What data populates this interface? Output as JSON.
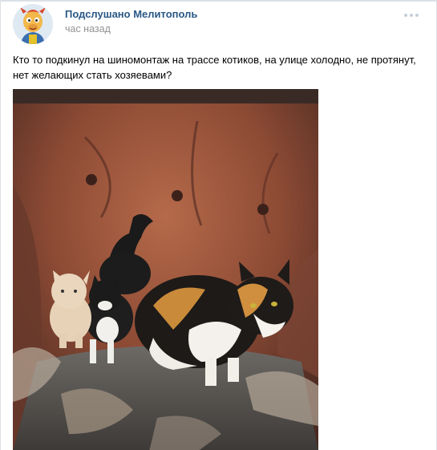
{
  "post": {
    "author": "Подслушано Мелитополь",
    "time": "час назад",
    "text": "Кто то подкинул на шиномонтаж на трассе котиков, на улице холодно, не протянут, нет желающих стать хозяевами?",
    "more_icon": "more-dots-icon",
    "avatar_icon": "cartoon-character-avatar"
  },
  "colors": {
    "author": "#2a5885",
    "time": "#939393",
    "border": "#dce1e6",
    "more_dots": "#c5d0db"
  }
}
